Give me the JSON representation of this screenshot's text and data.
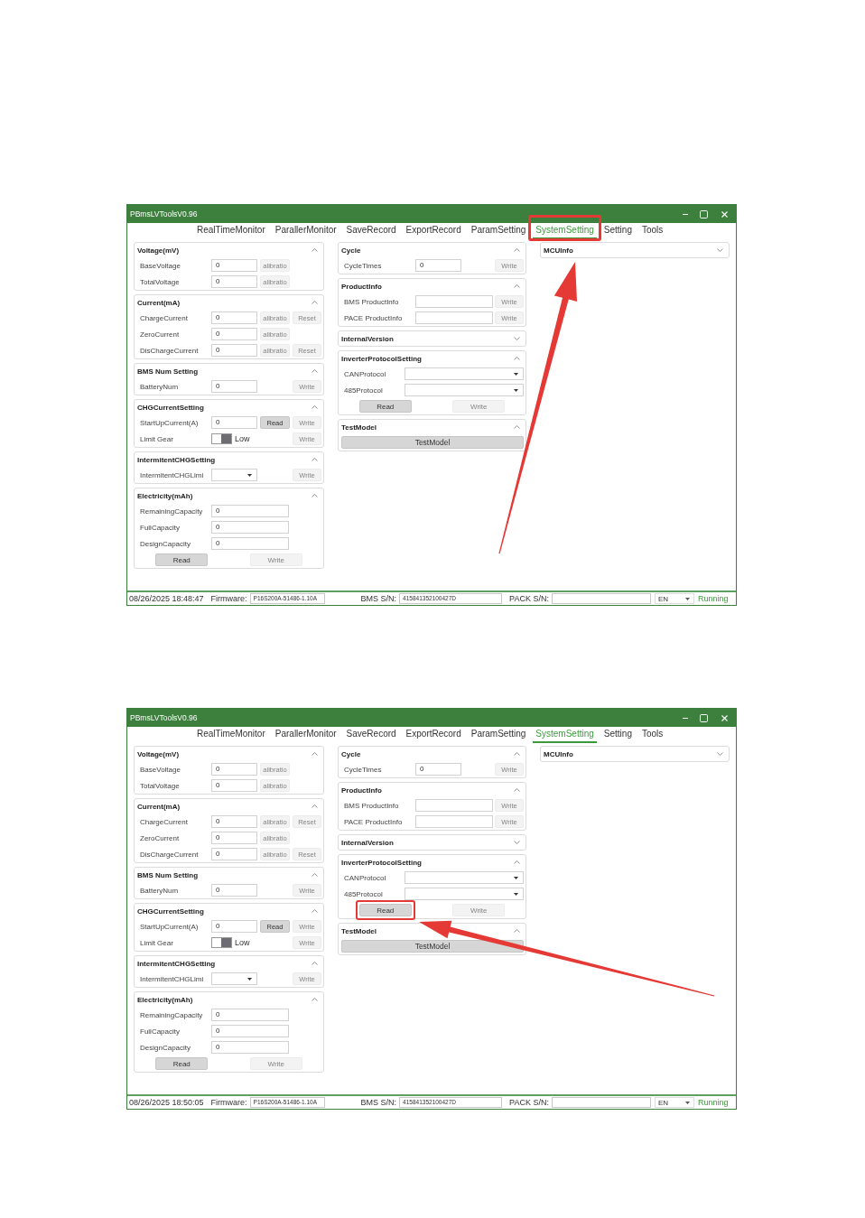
{
  "screenshots": [
    {
      "window": {
        "title": "PBmsLVToolsV0.96"
      },
      "tabs": [
        {
          "label": "RealTimeMonitor",
          "selected": false,
          "highlighted": false
        },
        {
          "label": "ParallerMonitor",
          "selected": false,
          "highlighted": false
        },
        {
          "label": "SaveRecord",
          "selected": false,
          "highlighted": false
        },
        {
          "label": "ExportRecord",
          "selected": false,
          "highlighted": false
        },
        {
          "label": "ParamSetting",
          "selected": false,
          "highlighted": false
        },
        {
          "label": "SystemSetting",
          "selected": true,
          "highlighted": true
        },
        {
          "label": "Setting",
          "selected": false,
          "highlighted": false
        },
        {
          "label": "Tools",
          "selected": false,
          "highlighted": false
        }
      ],
      "columns": [
        {
          "panels": [
            {
              "title": "Voltage(mV)",
              "expanded": true,
              "rows": [
                {
                  "kind": "setting",
                  "label": "BaseVoltage",
                  "field": {
                    "kind": "input",
                    "value": "0"
                  },
                  "buttons": [
                    {
                      "kind": "calibrate",
                      "label": "alibratio",
                      "disabled": true,
                      "highlighted": false
                    }
                  ]
                },
                {
                  "kind": "setting",
                  "label": "TotalVoltage",
                  "field": {
                    "kind": "input",
                    "value": "0"
                  },
                  "buttons": [
                    {
                      "kind": "calibrate",
                      "label": "alibratio",
                      "disabled": true,
                      "highlighted": false
                    }
                  ]
                }
              ]
            },
            {
              "title": "Current(mA)",
              "expanded": true,
              "rows": [
                {
                  "kind": "setting",
                  "label": "ChargeCurrent",
                  "field": {
                    "kind": "input",
                    "value": "0"
                  },
                  "buttons": [
                    {
                      "kind": "calibrate",
                      "label": "alibratio",
                      "disabled": true,
                      "highlighted": false
                    },
                    {
                      "kind": "reset",
                      "label": "Reset",
                      "disabled": true,
                      "highlighted": false
                    }
                  ]
                },
                {
                  "kind": "setting",
                  "label": "ZeroCurrent",
                  "field": {
                    "kind": "input",
                    "value": "0"
                  },
                  "buttons": [
                    {
                      "kind": "calibrate",
                      "label": "alibratio",
                      "disabled": true,
                      "highlighted": false
                    }
                  ]
                },
                {
                  "kind": "setting",
                  "label": "DisChargeCurrent",
                  "field": {
                    "kind": "input",
                    "value": "0"
                  },
                  "buttons": [
                    {
                      "kind": "calibrate",
                      "label": "alibratio",
                      "disabled": true,
                      "highlighted": false
                    },
                    {
                      "kind": "reset",
                      "label": "Reset",
                      "disabled": true,
                      "highlighted": false
                    }
                  ]
                }
              ]
            },
            {
              "title": "BMS Num Setting",
              "expanded": true,
              "rows": [
                {
                  "kind": "setting",
                  "label": "BatteryNum",
                  "field": {
                    "kind": "input",
                    "value": "0"
                  },
                  "buttons": [
                    {
                      "kind": "write",
                      "label": "Write",
                      "disabled": true,
                      "highlighted": false
                    }
                  ]
                }
              ]
            },
            {
              "title": "CHGCurrentSetting",
              "expanded": true,
              "rows": [
                {
                  "kind": "setting",
                  "label": "StartUpCurrent(A)",
                  "field": {
                    "kind": "input",
                    "value": "0"
                  },
                  "buttons": [
                    {
                      "kind": "read",
                      "label": "Read",
                      "disabled": false,
                      "highlighted": false
                    },
                    {
                      "kind": "write",
                      "label": "Write",
                      "disabled": true,
                      "highlighted": false
                    }
                  ]
                },
                {
                  "kind": "setting",
                  "label": "Limit Gear",
                  "field": {
                    "kind": "toggle",
                    "on": true,
                    "text": "Low"
                  },
                  "buttons": [
                    {
                      "kind": "write",
                      "label": "Write",
                      "disabled": true,
                      "highlighted": false
                    }
                  ]
                }
              ]
            },
            {
              "title": "IntermitentCHGSetting",
              "expanded": true,
              "rows": [
                {
                  "kind": "setting",
                  "label": "IntermitentCHGLimi",
                  "field": {
                    "kind": "select"
                  },
                  "buttons": [
                    {
                      "kind": "write",
                      "label": "Write",
                      "disabled": true,
                      "highlighted": false
                    }
                  ]
                }
              ]
            },
            {
              "title": "Electricity(mAh)",
              "expanded": true,
              "rows": [
                {
                  "kind": "setting",
                  "label": "RemainingCapacity",
                  "field": {
                    "kind": "wide-input",
                    "value": "0"
                  }
                },
                {
                  "kind": "setting",
                  "label": "FullCapacity",
                  "field": {
                    "kind": "wide-input",
                    "value": "0"
                  }
                },
                {
                  "kind": "setting",
                  "label": "DesignCapacity",
                  "field": {
                    "kind": "wide-input",
                    "value": "0"
                  }
                },
                {
                  "kind": "actions",
                  "buttons": [
                    {
                      "kind": "read",
                      "label": "Read",
                      "disabled": false,
                      "highlighted": false
                    },
                    {
                      "kind": "write",
                      "label": "Write",
                      "disabled": true,
                      "highlighted": false
                    }
                  ]
                }
              ]
            }
          ]
        },
        {
          "panels": [
            {
              "title": "Cycle",
              "expanded": true,
              "rows": [
                {
                  "kind": "setting",
                  "label": "CycleTimes",
                  "field": {
                    "kind": "input",
                    "value": "0"
                  },
                  "buttons": [
                    {
                      "kind": "write",
                      "label": "Write",
                      "disabled": true,
                      "highlighted": false
                    }
                  ]
                }
              ]
            },
            {
              "title": "ProductInfo",
              "expanded": true,
              "rows": [
                {
                  "kind": "setting",
                  "label": "BMS ProductInfo",
                  "field": {
                    "kind": "wide-input"
                  },
                  "buttons": [
                    {
                      "kind": "write",
                      "label": "Write",
                      "disabled": true,
                      "highlighted": false
                    }
                  ]
                },
                {
                  "kind": "setting",
                  "label": "PACE ProductInfo",
                  "field": {
                    "kind": "wide-input"
                  },
                  "buttons": [
                    {
                      "kind": "write",
                      "label": "Write",
                      "disabled": true,
                      "highlighted": false
                    }
                  ]
                }
              ]
            },
            {
              "title": "InternalVersion",
              "expanded": false
            },
            {
              "title": "InverterProtocolSetting",
              "expanded": true,
              "rows": [
                {
                  "kind": "setting",
                  "label": "CANProtocol",
                  "field": {
                    "kind": "wide-select"
                  }
                },
                {
                  "kind": "setting",
                  "label": "485Protocol",
                  "field": {
                    "kind": "wide-select"
                  }
                },
                {
                  "kind": "actions",
                  "buttons": [
                    {
                      "kind": "read",
                      "label": "Read",
                      "disabled": false,
                      "highlighted": false
                    },
                    {
                      "kind": "write",
                      "label": "Write",
                      "disabled": true,
                      "highlighted": false
                    }
                  ]
                }
              ]
            },
            {
              "title": "TestModel",
              "expanded": true,
              "rows": [
                {
                  "kind": "full",
                  "buttons": [
                    {
                      "kind": "test",
                      "label": "TestModel",
                      "disabled": false,
                      "highlighted": false
                    }
                  ]
                }
              ]
            }
          ]
        },
        {
          "panels": [
            {
              "title": "MCUInfo",
              "expanded": false
            }
          ]
        }
      ],
      "status_bar": {
        "datetime": "08/26/2025 18:48:47",
        "fields": [
          {
            "label": "Firmware:",
            "value": "P16S200A-51486-1.10A"
          },
          {
            "label": "BMS S/N:",
            "value": "415841352100427D"
          },
          {
            "label": "PACK S/N:"
          }
        ],
        "language": "EN",
        "status": "Running"
      },
      "arrow": {
        "kind": "up"
      }
    },
    {
      "window": {
        "title": "PBmsLVToolsV0.96"
      },
      "tabs": [
        {
          "label": "RealTimeMonitor",
          "selected": false,
          "highlighted": false
        },
        {
          "label": "ParallerMonitor",
          "selected": false,
          "highlighted": false
        },
        {
          "label": "SaveRecord",
          "selected": false,
          "highlighted": false
        },
        {
          "label": "ExportRecord",
          "selected": false,
          "highlighted": false
        },
        {
          "label": "ParamSetting",
          "selected": false,
          "highlighted": false
        },
        {
          "label": "SystemSetting",
          "selected": true,
          "highlighted": false
        },
        {
          "label": "Setting",
          "selected": false,
          "highlighted": false
        },
        {
          "label": "Tools",
          "selected": false,
          "highlighted": false
        }
      ],
      "columns": [
        {
          "panels": [
            {
              "title": "Voltage(mV)",
              "expanded": true,
              "rows": [
                {
                  "kind": "setting",
                  "label": "BaseVoltage",
                  "field": {
                    "kind": "input",
                    "value": "0"
                  },
                  "buttons": [
                    {
                      "kind": "calibrate",
                      "label": "alibratio",
                      "disabled": true,
                      "highlighted": false
                    }
                  ]
                },
                {
                  "kind": "setting",
                  "label": "TotalVoltage",
                  "field": {
                    "kind": "input",
                    "value": "0"
                  },
                  "buttons": [
                    {
                      "kind": "calibrate",
                      "label": "alibratio",
                      "disabled": true,
                      "highlighted": false
                    }
                  ]
                }
              ]
            },
            {
              "title": "Current(mA)",
              "expanded": true,
              "rows": [
                {
                  "kind": "setting",
                  "label": "ChargeCurrent",
                  "field": {
                    "kind": "input",
                    "value": "0"
                  },
                  "buttons": [
                    {
                      "kind": "calibrate",
                      "label": "alibratio",
                      "disabled": true,
                      "highlighted": false
                    },
                    {
                      "kind": "reset",
                      "label": "Reset",
                      "disabled": true,
                      "highlighted": false
                    }
                  ]
                },
                {
                  "kind": "setting",
                  "label": "ZeroCurrent",
                  "field": {
                    "kind": "input",
                    "value": "0"
                  },
                  "buttons": [
                    {
                      "kind": "calibrate",
                      "label": "alibratio",
                      "disabled": true,
                      "highlighted": false
                    }
                  ]
                },
                {
                  "kind": "setting",
                  "label": "DisChargeCurrent",
                  "field": {
                    "kind": "input",
                    "value": "0"
                  },
                  "buttons": [
                    {
                      "kind": "calibrate",
                      "label": "alibratio",
                      "disabled": true,
                      "highlighted": false
                    },
                    {
                      "kind": "reset",
                      "label": "Reset",
                      "disabled": true,
                      "highlighted": false
                    }
                  ]
                }
              ]
            },
            {
              "title": "BMS Num Setting",
              "expanded": true,
              "rows": [
                {
                  "kind": "setting",
                  "label": "BatteryNum",
                  "field": {
                    "kind": "input",
                    "value": "0"
                  },
                  "buttons": [
                    {
                      "kind": "write",
                      "label": "Write",
                      "disabled": true,
                      "highlighted": false
                    }
                  ]
                }
              ]
            },
            {
              "title": "CHGCurrentSetting",
              "expanded": true,
              "rows": [
                {
                  "kind": "setting",
                  "label": "StartUpCurrent(A)",
                  "field": {
                    "kind": "input",
                    "value": "0"
                  },
                  "buttons": [
                    {
                      "kind": "read",
                      "label": "Read",
                      "disabled": false,
                      "highlighted": false
                    },
                    {
                      "kind": "write",
                      "label": "Write",
                      "disabled": true,
                      "highlighted": false
                    }
                  ]
                },
                {
                  "kind": "setting",
                  "label": "Limit Gear",
                  "field": {
                    "kind": "toggle",
                    "on": true,
                    "text": "Low"
                  },
                  "buttons": [
                    {
                      "kind": "write",
                      "label": "Write",
                      "disabled": true,
                      "highlighted": false
                    }
                  ]
                }
              ]
            },
            {
              "title": "IntermitentCHGSetting",
              "expanded": true,
              "rows": [
                {
                  "kind": "setting",
                  "label": "IntermitentCHGLimi",
                  "field": {
                    "kind": "select"
                  },
                  "buttons": [
                    {
                      "kind": "write",
                      "label": "Write",
                      "disabled": true,
                      "highlighted": false
                    }
                  ]
                }
              ]
            },
            {
              "title": "Electricity(mAh)",
              "expanded": true,
              "rows": [
                {
                  "kind": "setting",
                  "label": "RemainingCapacity",
                  "field": {
                    "kind": "wide-input",
                    "value": "0"
                  }
                },
                {
                  "kind": "setting",
                  "label": "FullCapacity",
                  "field": {
                    "kind": "wide-input",
                    "value": "0"
                  }
                },
                {
                  "kind": "setting",
                  "label": "DesignCapacity",
                  "field": {
                    "kind": "wide-input",
                    "value": "0"
                  }
                },
                {
                  "kind": "actions",
                  "buttons": [
                    {
                      "kind": "read",
                      "label": "Read",
                      "disabled": false,
                      "highlighted": false
                    },
                    {
                      "kind": "write",
                      "label": "Write",
                      "disabled": true,
                      "highlighted": false
                    }
                  ]
                }
              ]
            }
          ]
        },
        {
          "panels": [
            {
              "title": "Cycle",
              "expanded": true,
              "rows": [
                {
                  "kind": "setting",
                  "label": "CycleTimes",
                  "field": {
                    "kind": "input",
                    "value": "0"
                  },
                  "buttons": [
                    {
                      "kind": "write",
                      "label": "Write",
                      "disabled": true,
                      "highlighted": false
                    }
                  ]
                }
              ]
            },
            {
              "title": "ProductInfo",
              "expanded": true,
              "rows": [
                {
                  "kind": "setting",
                  "label": "BMS ProductInfo",
                  "field": {
                    "kind": "wide-input"
                  },
                  "buttons": [
                    {
                      "kind": "write",
                      "label": "Write",
                      "disabled": true,
                      "highlighted": false
                    }
                  ]
                },
                {
                  "kind": "setting",
                  "label": "PACE ProductInfo",
                  "field": {
                    "kind": "wide-input"
                  },
                  "buttons": [
                    {
                      "kind": "write",
                      "label": "Write",
                      "disabled": true,
                      "highlighted": false
                    }
                  ]
                }
              ]
            },
            {
              "title": "InternalVersion",
              "expanded": false
            },
            {
              "title": "InverterProtocolSetting",
              "expanded": true,
              "rows": [
                {
                  "kind": "setting",
                  "label": "CANProtocol",
                  "field": {
                    "kind": "wide-select"
                  }
                },
                {
                  "kind": "setting",
                  "label": "485Protocol",
                  "field": {
                    "kind": "wide-select"
                  }
                },
                {
                  "kind": "actions",
                  "buttons": [
                    {
                      "kind": "read",
                      "label": "Read",
                      "disabled": false,
                      "highlighted": true
                    },
                    {
                      "kind": "write",
                      "label": "Write",
                      "disabled": true,
                      "highlighted": false
                    }
                  ]
                }
              ]
            },
            {
              "title": "TestModel",
              "expanded": true,
              "rows": [
                {
                  "kind": "full",
                  "buttons": [
                    {
                      "kind": "test",
                      "label": "TestModel",
                      "disabled": false,
                      "highlighted": false
                    }
                  ]
                }
              ]
            }
          ]
        },
        {
          "panels": [
            {
              "title": "MCUInfo",
              "expanded": false
            }
          ]
        }
      ],
      "status_bar": {
        "datetime": "08/26/2025 18:50:05",
        "fields": [
          {
            "label": "Firmware:",
            "value": "P16S200A-51486-1.10A"
          },
          {
            "label": "BMS S/N:",
            "value": "415841352100427D"
          },
          {
            "label": "PACK S/N:"
          }
        ],
        "language": "EN",
        "status": "Running"
      },
      "arrow": {
        "kind": "left"
      }
    }
  ]
}
